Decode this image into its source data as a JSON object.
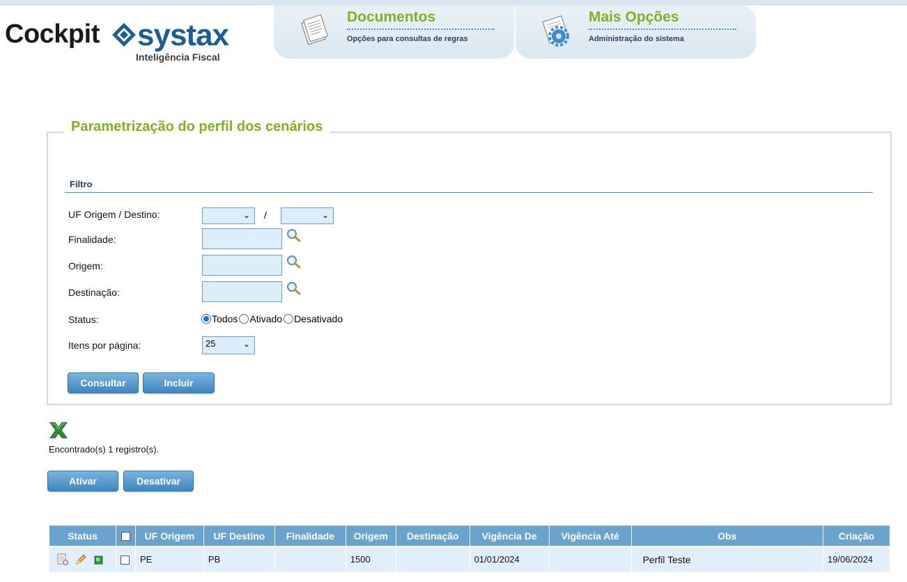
{
  "logo": {
    "brand_left": "Cockpit",
    "brand_right": "systax",
    "tagline": "Inteligência Fiscal"
  },
  "menu": {
    "documentos": {
      "title": "Documentos",
      "subtitle": "Opções para consultas de regras",
      "icon": "documents-icon"
    },
    "mais_opcoes": {
      "title": "Mais Opções",
      "subtitle": "Administração do sistema",
      "icon": "settings-gear-icon"
    }
  },
  "panel": {
    "title": "Parametrização do perfil dos cenários",
    "filter_heading": "Filtro"
  },
  "form": {
    "uf_label": "UF Origem / Destino:",
    "uf_origem_value": "",
    "uf_separator": "/",
    "uf_destino_value": "",
    "finalidade_label": "Finalidade:",
    "finalidade_value": "",
    "origem_label": "Origem:",
    "origem_value": "",
    "destinacao_label": "Destinação:",
    "destinacao_value": "",
    "status_label": "Status:",
    "status_options": [
      "Todos",
      "Ativado",
      "Desativado"
    ],
    "status_selected": "Todos",
    "itens_label": "Itens por página:",
    "itens_value": "25"
  },
  "buttons": {
    "consultar": "Consultar",
    "incluir": "Incluir",
    "ativar": "Ativar",
    "desativar": "Desativar"
  },
  "results": {
    "found_text": "Encontrado(s) 1 registro(s).",
    "export_icon": "excel-export-icon"
  },
  "table": {
    "headers": [
      "Status",
      "",
      "UF Origem",
      "UF Destino",
      "Finalidade",
      "Origem",
      "Destinação",
      "Vigência De",
      "Vigência Até",
      "Obs",
      "Criação"
    ],
    "rows": [
      {
        "icons": [
          "view-document-icon",
          "edit-pencil-icon",
          "active-status-icon"
        ],
        "checked": false,
        "uf_origem": "PE",
        "uf_destino": "PB",
        "finalidade": "",
        "origem": "1500",
        "destinacao": "",
        "vigencia_de": "01/01/2024",
        "vigencia_ate": "",
        "obs": "Perfil Teste",
        "criacao": "19/06/2024"
      }
    ]
  },
  "colors": {
    "brand_blue": "#1a5e97",
    "accent_green": "#7fb21e",
    "table_header": "#6ba3cf",
    "table_row": "#e2eefa",
    "input_bg": "#ddeefb"
  }
}
